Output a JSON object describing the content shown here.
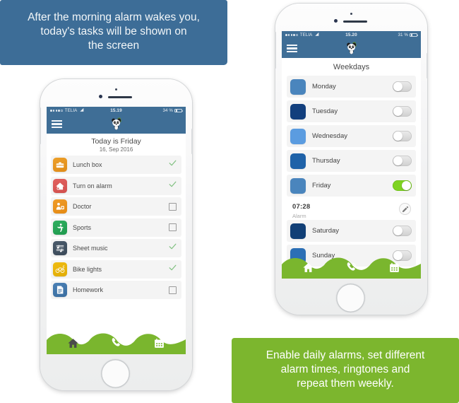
{
  "captions": {
    "top": "After the morning alarm wakes you, today's tasks will be shown on the screen",
    "top_lines": [
      "After the morning alarm wakes you,",
      "today's tasks will be shown on",
      "the screen"
    ],
    "bottom": "Enable daily alarms, set different alarm times, ringtones and repeat them weekly.",
    "bottom_lines": [
      "Enable daily alarms, set different",
      "alarm times, ringtones and",
      "repeat them weekly."
    ],
    "top_bg": "#3d6d97",
    "bottom_bg": "#7cb62e"
  },
  "theme": {
    "nav_blue": "#3f6e96",
    "green": "#7ab62e",
    "toggle_on": "#7ed321",
    "check_green": "#7fc07f",
    "row_bg": "#f4f4f4"
  },
  "left_phone": {
    "status": {
      "carrier": "TELIA",
      "wifi_icon": "wifi-icon",
      "time": "15.19",
      "battery": "34 %",
      "signal_dots": 5,
      "signal_filled": 4
    },
    "nav": {
      "menu_icon": "hamburger-menu-icon",
      "logo_icon": "panda-logo-icon"
    },
    "header": {
      "title": "Today is Friday",
      "subtitle": "16, Sep 2016"
    },
    "tasks": [
      {
        "label": "Lunch box",
        "icon": "lunchbox-icon",
        "color": "#eda02a",
        "color2": "#e08c18",
        "done": true
      },
      {
        "label": "Turn on alarm",
        "icon": "house-alarm-icon",
        "color": "#e2605e",
        "color2": "#d14f4d",
        "done": true
      },
      {
        "label": "Doctor",
        "icon": "doctor-icon",
        "color": "#ef9c2a",
        "color2": "#e58a13",
        "done": false
      },
      {
        "label": "Sports",
        "icon": "sports-icon",
        "color": "#2fae5f",
        "color2": "#1f9a4e",
        "done": false
      },
      {
        "label": "Sheet music",
        "icon": "sheet-music-icon",
        "color": "#4a5a6b",
        "color2": "#3b4a59",
        "done": true
      },
      {
        "label": "Bike lights",
        "icon": "bike-lights-icon",
        "color": "#f0bc12",
        "color2": "#e0ac05",
        "done": true
      },
      {
        "label": "Homework",
        "icon": "homework-icon",
        "color": "#4a80b5",
        "color2": "#3a6d9f",
        "done": false
      }
    ],
    "footer": {
      "items": [
        {
          "icon": "home-icon",
          "name": "nav-home"
        },
        {
          "icon": "ringtone-icon",
          "name": "nav-ringtone"
        },
        {
          "icon": "calendar-icon",
          "name": "nav-calendar"
        }
      ]
    }
  },
  "right_phone": {
    "status": {
      "carrier": "TELIA",
      "wifi_icon": "wifi-icon",
      "time": "15.20",
      "battery": "31 %",
      "signal_dots": 5,
      "signal_filled": 4
    },
    "nav": {
      "menu_icon": "hamburger-menu-icon",
      "logo_icon": "panda-logo-icon"
    },
    "title": "Weekdays",
    "days": [
      {
        "label": "Monday",
        "color": "#4a85bd",
        "on": false
      },
      {
        "label": "Tuesday",
        "color": "#123f7d",
        "on": false
      },
      {
        "label": "Wednesday",
        "color": "#5b9ce0",
        "on": false
      },
      {
        "label": "Thursday",
        "color": "#1f62a8",
        "on": false
      },
      {
        "label": "Friday",
        "color": "#4a85bd",
        "on": true
      },
      {
        "label": "Saturday",
        "color": "#113f76",
        "on": false
      },
      {
        "label": "Sunday",
        "color": "#2b6fb5",
        "on": false
      }
    ],
    "alarm": {
      "time": "07:28",
      "label": "Alarm",
      "edit_icon": "pencil-edit-icon"
    },
    "footer": {
      "items": [
        {
          "icon": "home-icon",
          "name": "nav-home"
        },
        {
          "icon": "ringtone-icon",
          "name": "nav-ringtone"
        },
        {
          "icon": "calendar-icon",
          "name": "nav-calendar"
        }
      ]
    }
  }
}
